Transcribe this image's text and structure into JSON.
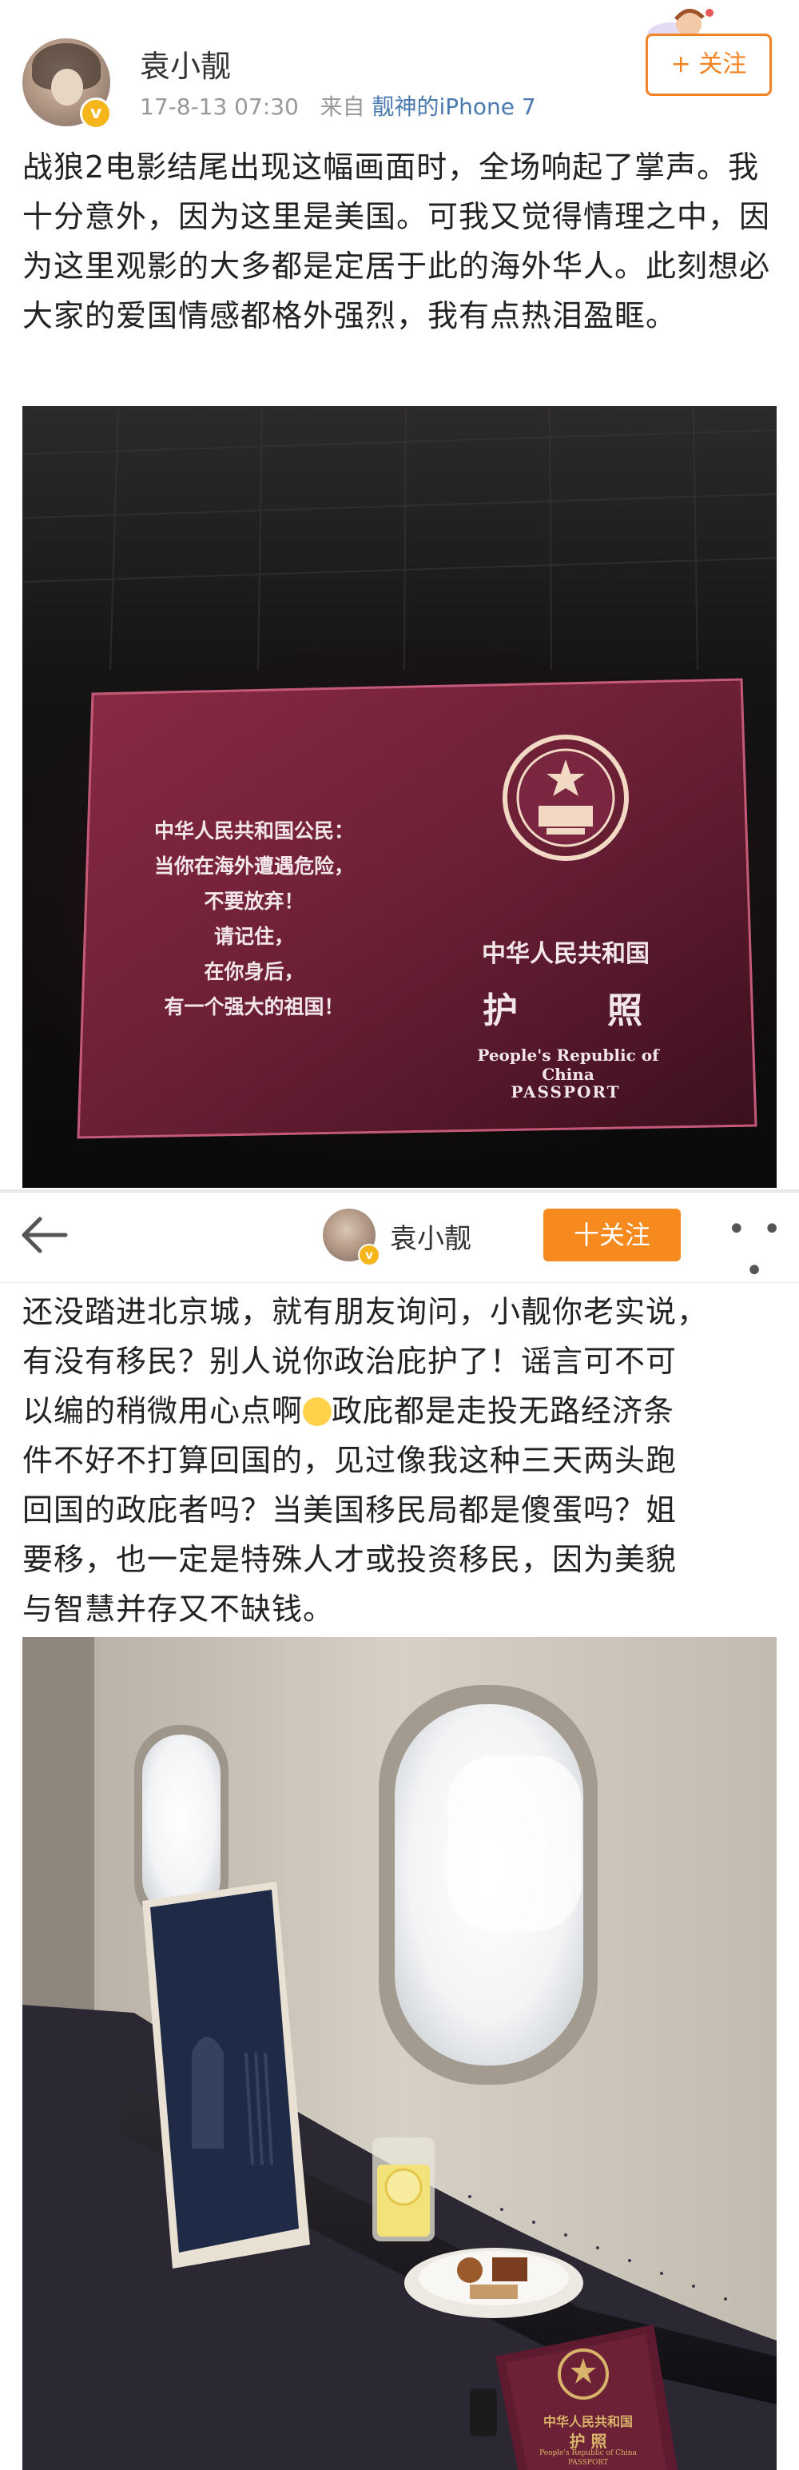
{
  "post1": {
    "username": "袁小靓",
    "timestamp": "17-8-13 07:30",
    "source_prefix": "来自",
    "source_device": "靓神的iPhone 7",
    "follow_label": "+ 关注",
    "text": "战狼2电影结尾出现这幅画面时，全场响起了掌声。我十分意外，因为这里是美国。可我又觉得情理之中，因为这里观影的大多都是定居于此的海外华人。此刻想必大家的爱国情感都格外强烈，我有点热泪盈眶。",
    "passport": {
      "left_lines": [
        "中华人民共和国公民：",
        "当你在海外遭遇危险，",
        "不要放弃！",
        "请记住，",
        "在你身后，",
        "有一个强大的祖国！"
      ],
      "country_cn": "中华人民共和国",
      "passport_cn": "护　　照",
      "country_en": "People's Republic of China",
      "passport_en": "PASSPORT"
    }
  },
  "post2": {
    "username": "袁小靓",
    "follow_label": "十关注",
    "more_label": "• • •",
    "text_line1": "还没踏进北京城，就有朋友询问，小靓你老实说，",
    "text_line2": "有没有移民？别人说你政治庇护了！谣言可不可",
    "text_line3a": "以编的稍微用心点啊",
    "text_line3b": "政庇都是走投无路经济条",
    "text_line4": "件不好不打算回国的，见过像我这种三天两头跑",
    "text_line5": "回国的政庇者吗？当美国移民局都是傻蛋吗？姐",
    "text_line6": "要移，也一定是特殊人才或投资移民，因为美貌",
    "text_line7": "与智慧并存又不缺钱。",
    "passport_small": {
      "country_cn": "中华人民共和国",
      "passport_cn": "护  照",
      "country_en": "People's Republic of China",
      "passport_en": "PASSPORT"
    }
  },
  "icons": [
    "v-verified-icon",
    "back-arrow-icon",
    "more-icon",
    "crying-laughing-emoji-icon"
  ],
  "colors": {
    "accent": "#f68a1f",
    "link": "#4a7bb0",
    "passport": "#6b1f35"
  }
}
